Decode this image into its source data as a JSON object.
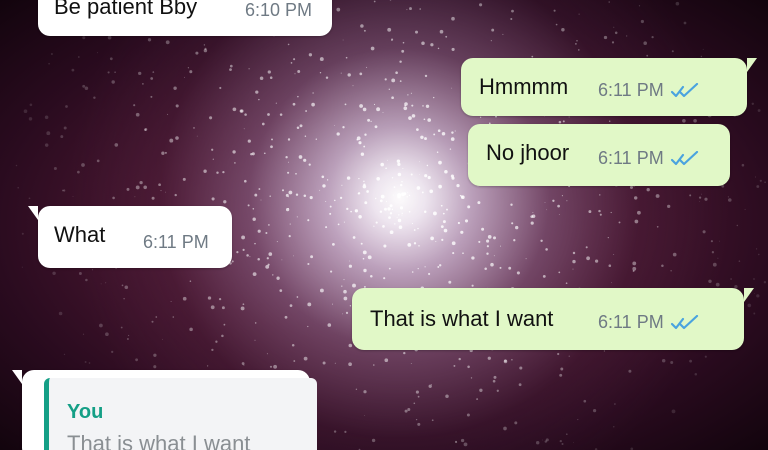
{
  "messages": [
    {
      "direction": "incoming",
      "text": "Be patient Bby",
      "time": "6:10 PM"
    },
    {
      "direction": "outgoing",
      "text": "Hmmmm",
      "time": "6:11 PM",
      "status_icon": "double-check-icon"
    },
    {
      "direction": "outgoing",
      "text": "No jhoor",
      "time": "6:11 PM",
      "status_icon": "double-check-icon"
    },
    {
      "direction": "incoming",
      "text": "What",
      "time": "6:11 PM"
    },
    {
      "direction": "outgoing",
      "text": "That is what I want",
      "time": "6:11 PM",
      "status_icon": "double-check-icon"
    },
    {
      "direction": "incoming",
      "reply_preview": {
        "author": "You",
        "text": "That is what I want"
      }
    }
  ],
  "colors": {
    "incoming_bubble": "#ffffff",
    "outgoing_bubble": "#e1f8c7",
    "timestamp": "#6f7a84",
    "read_ticks": "#4aa3df",
    "reply_accent": "#149f86"
  }
}
